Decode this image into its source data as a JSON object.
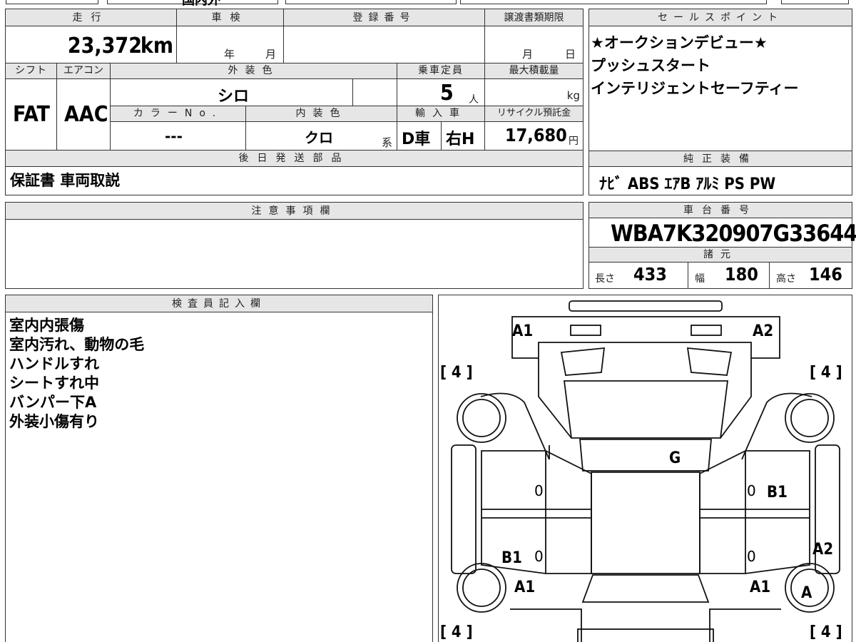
{
  "top_fragment": "国内外",
  "row1": {
    "mileage_label": "走行",
    "mileage_value": "23,372",
    "mileage_unit": "km",
    "inspection_label": "車検",
    "inspection_year": "年",
    "inspection_month": "月",
    "registration_label": "登録番号",
    "transfer_label": "譲渡書類期限",
    "transfer_month": "月",
    "transfer_day": "日"
  },
  "row2": {
    "shift_label": "シフト",
    "shift_value": "FAT",
    "aircon_label": "エアコン",
    "aircon_value": "AAC",
    "exterior_label": "外装色",
    "exterior_value": "シロ",
    "capacity_label": "乗車定員",
    "capacity_value": "5",
    "capacity_unit": "人",
    "load_label": "最大積載量",
    "load_unit": "kg",
    "color_no_label": "カラーNo.",
    "color_no_value": "---",
    "interior_label": "内装色",
    "interior_value": "クロ",
    "interior_suffix": "系",
    "import_label": "輸入車",
    "import_value": "D車",
    "handle_value": "右H",
    "recycle_label": "リサイクル預託金",
    "recycle_value": "17,680",
    "recycle_unit": "円"
  },
  "later_parts": {
    "label": "後日発送部品",
    "value": "保証書 車両取説"
  },
  "sales_point": {
    "label": "セールスポイント",
    "lines": [
      "★オークションデビュー★",
      "プッシュスタート",
      "インテリジェントセーフティー"
    ]
  },
  "equipment": {
    "label": "純正装備",
    "value": "ﾅﾋﾞ ABS ｴｱB ｱﾙﾐ PS PW"
  },
  "caution": {
    "label": "注意事項欄"
  },
  "chassis": {
    "label": "車台番号",
    "value": "WBA7K320907G33644"
  },
  "specs": {
    "label": "諸元",
    "length_label": "長さ",
    "length_value": "433",
    "width_label": "幅",
    "width_value": "180",
    "height_label": "高さ",
    "height_value": "146"
  },
  "inspector": {
    "label": "検査員記入欄",
    "lines": [
      "室内内張傷",
      "室内汚れ、動物の毛",
      "ハンドルすれ",
      "シートすれ中",
      "バンパー下A",
      "外装小傷有り"
    ]
  },
  "diagram": {
    "marks": {
      "a1_front_left": "A1",
      "a2_front_right": "A2",
      "tire_fl": "[ 4 ]",
      "tire_fr": "[ 4 ]",
      "tire_rl": "[ 4 ]",
      "tire_rr": "[ 4 ]",
      "g_glass": "G",
      "b1_right": "B1",
      "b1_left": "B1",
      "a2_right_rear": "A2",
      "a1_rear_left": "A1",
      "a1_rear_right": "A1",
      "a_wheel": "A",
      "zero1": "0",
      "zero2": "0",
      "zero3": "0",
      "zero4": "0"
    }
  }
}
